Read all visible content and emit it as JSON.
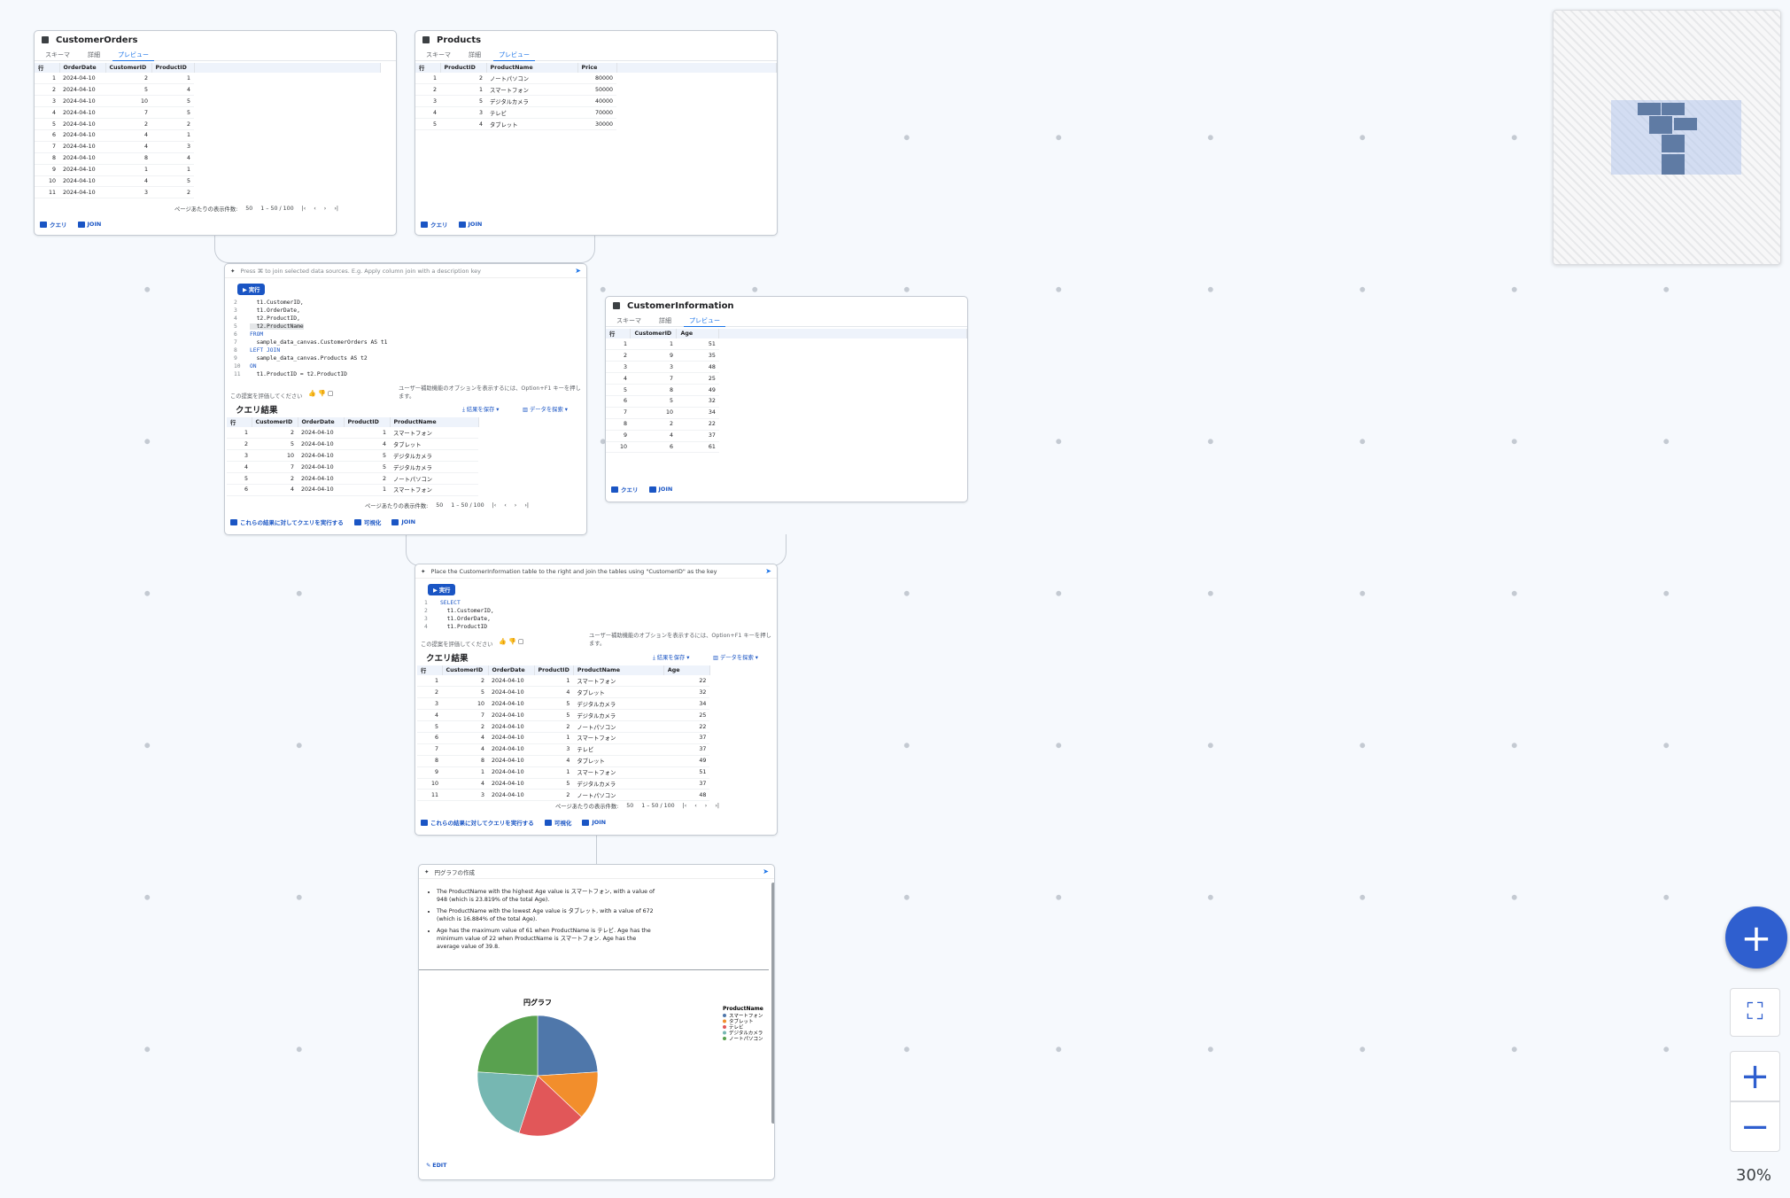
{
  "customer_orders": {
    "title": "CustomerOrders",
    "tabs": [
      "スキーマ",
      "詳細",
      "プレビュー"
    ],
    "columns": [
      "行",
      "OrderDate",
      "CustomerID",
      "ProductID"
    ],
    "rows": [
      [
        "1",
        "2024-04-10",
        "2",
        "1"
      ],
      [
        "2",
        "2024-04-10",
        "5",
        "4"
      ],
      [
        "3",
        "2024-04-10",
        "10",
        "5"
      ],
      [
        "4",
        "2024-04-10",
        "7",
        "5"
      ],
      [
        "5",
        "2024-04-10",
        "2",
        "2"
      ],
      [
        "6",
        "2024-04-10",
        "4",
        "1"
      ],
      [
        "7",
        "2024-04-10",
        "4",
        "3"
      ],
      [
        "8",
        "2024-04-10",
        "8",
        "4"
      ],
      [
        "9",
        "2024-04-10",
        "1",
        "1"
      ],
      [
        "10",
        "2024-04-10",
        "4",
        "5"
      ],
      [
        "11",
        "2024-04-10",
        "3",
        "2"
      ]
    ],
    "page_size_label": "ページあたりの表示件数:",
    "page_size": "50",
    "range": "1 – 50 / 100",
    "query_label": "クエリ",
    "join_label": "JOIN"
  },
  "products": {
    "title": "Products",
    "tabs": [
      "スキーマ",
      "詳細",
      "プレビュー"
    ],
    "columns": [
      "行",
      "ProductID",
      "ProductName",
      "Price"
    ],
    "rows": [
      [
        "1",
        "2",
        "ノートパソコン",
        "80000"
      ],
      [
        "2",
        "1",
        "スマートフォン",
        "50000"
      ],
      [
        "3",
        "5",
        "デジタルカメラ",
        "40000"
      ],
      [
        "4",
        "3",
        "テレビ",
        "70000"
      ],
      [
        "5",
        "4",
        "タブレット",
        "30000"
      ]
    ],
    "query_label": "クエリ",
    "join_label": "JOIN"
  },
  "customer_information": {
    "title": "CustomerInformation",
    "tabs": [
      "スキーマ",
      "詳細",
      "プレビュー"
    ],
    "columns": [
      "行",
      "CustomerID",
      "Age"
    ],
    "rows": [
      [
        "1",
        "1",
        "51"
      ],
      [
        "2",
        "9",
        "35"
      ],
      [
        "3",
        "3",
        "48"
      ],
      [
        "4",
        "7",
        "25"
      ],
      [
        "5",
        "8",
        "49"
      ],
      [
        "6",
        "5",
        "32"
      ],
      [
        "7",
        "10",
        "34"
      ],
      [
        "8",
        "2",
        "22"
      ],
      [
        "9",
        "4",
        "37"
      ],
      [
        "10",
        "6",
        "61"
      ]
    ],
    "query_label": "クエリ",
    "join_label": "JOIN"
  },
  "query1": {
    "prompt": "Press ⌘ to join selected data sources. E.g. Apply column join with a description key",
    "run_label": "実行",
    "code_lines": [
      {
        "n": "2",
        "t": "  t1.CustomerID,"
      },
      {
        "n": "3",
        "t": "  t1.OrderDate,"
      },
      {
        "n": "4",
        "t": "  t2.ProductID,"
      },
      {
        "n": "5",
        "t": "  t2.ProductName"
      },
      {
        "n": "6",
        "t": "FROM"
      },
      {
        "n": "7",
        "t": "  sample_data_canvas.CustomerOrders AS t1"
      },
      {
        "n": "8",
        "t": "LEFT JOIN"
      },
      {
        "n": "9",
        "t": "  sample_data_canvas.Products AS t2"
      },
      {
        "n": "10",
        "t": "ON"
      },
      {
        "n": "11",
        "t": "  t1.ProductID = t2.ProductID"
      }
    ],
    "hint": "ユーザー補助機能のオプションを表示するには、Option+F1 キーを押します。",
    "rate_label": "この提案を評価してください",
    "results_title": "クエリ結果",
    "save_label": "結果を保存",
    "explore_label": "データを探索",
    "columns": [
      "行",
      "CustomerID",
      "OrderDate",
      "ProductID",
      "ProductName"
    ],
    "rows": [
      [
        "1",
        "2",
        "2024-04-10",
        "1",
        "スマートフォン"
      ],
      [
        "2",
        "5",
        "2024-04-10",
        "4",
        "タブレット"
      ],
      [
        "3",
        "10",
        "2024-04-10",
        "5",
        "デジタルカメラ"
      ],
      [
        "4",
        "7",
        "2024-04-10",
        "5",
        "デジタルカメラ"
      ],
      [
        "5",
        "2",
        "2024-04-10",
        "2",
        "ノートパソコン"
      ],
      [
        "6",
        "4",
        "2024-04-10",
        "1",
        "スマートフォン"
      ]
    ],
    "page_size_label": "ページあたりの表示件数:",
    "page_size": "50",
    "range": "1 – 50 / 100",
    "run_on_results": "これらの結果に対してクエリを実行する",
    "visualize": "可視化",
    "join_label": "JOIN"
  },
  "query2": {
    "prompt": "Place the CustomerInformation table to the right and join the tables using \"CustomerID\" as the key",
    "run_label": "実行",
    "code_lines": [
      {
        "n": "1",
        "t": "SELECT"
      },
      {
        "n": "2",
        "t": "  t1.CustomerID,"
      },
      {
        "n": "3",
        "t": "  t1.OrderDate,"
      },
      {
        "n": "4",
        "t": "  t1.ProductID"
      }
    ],
    "hint": "ユーザー補助機能のオプションを表示するには、Option+F1 キーを押します。",
    "rate_label": "この提案を評価してください",
    "results_title": "クエリ結果",
    "save_label": "結果を保存",
    "explore_label": "データを探索",
    "columns": [
      "行",
      "CustomerID",
      "OrderDate",
      "ProductID",
      "ProductName",
      "Age"
    ],
    "rows": [
      [
        "1",
        "2",
        "2024-04-10",
        "1",
        "スマートフォン",
        "22"
      ],
      [
        "2",
        "5",
        "2024-04-10",
        "4",
        "タブレット",
        "32"
      ],
      [
        "3",
        "10",
        "2024-04-10",
        "5",
        "デジタルカメラ",
        "34"
      ],
      [
        "4",
        "7",
        "2024-04-10",
        "5",
        "デジタルカメラ",
        "25"
      ],
      [
        "5",
        "2",
        "2024-04-10",
        "2",
        "ノートパソコン",
        "22"
      ],
      [
        "6",
        "4",
        "2024-04-10",
        "1",
        "スマートフォン",
        "37"
      ],
      [
        "7",
        "4",
        "2024-04-10",
        "3",
        "テレビ",
        "37"
      ],
      [
        "8",
        "8",
        "2024-04-10",
        "4",
        "タブレット",
        "49"
      ],
      [
        "9",
        "1",
        "2024-04-10",
        "1",
        "スマートフォン",
        "51"
      ],
      [
        "10",
        "4",
        "2024-04-10",
        "5",
        "デジタルカメラ",
        "37"
      ],
      [
        "11",
        "3",
        "2024-04-10",
        "2",
        "ノートパソコン",
        "48"
      ]
    ],
    "page_size_label": "ページあたりの表示件数:",
    "page_size": "50",
    "range": "1 – 50 / 100",
    "run_on_results": "これらの結果に対してクエリを実行する",
    "visualize": "可視化",
    "join_label": "JOIN"
  },
  "visualization": {
    "prompt": "円グラフの作成",
    "bullets": [
      "The ProductName with the highest Age value is スマートフォン, with a value of 948 (which is 23.819% of the total Age).",
      "The ProductName with the lowest Age value is タブレット, with a value of 672 (which is 16.884% of the total Age).",
      "Age has the maximum value of 61 when ProductName is テレビ. Age has the minimum value of 22 when ProductName is スマートフォン. Age has the average value of 39.8."
    ],
    "edit_label": "EDIT"
  },
  "chart_data": {
    "type": "pie",
    "title": "円グラフ",
    "legend_title": "ProductName",
    "categories": [
      "スマートフォン",
      "タブレット",
      "テレビ",
      "デジタルカメラ",
      "ノートパソコン"
    ],
    "values": [
      24,
      13,
      18,
      21,
      24
    ],
    "colors": [
      "#4f77aa",
      "#f28e2c",
      "#e15759",
      "#76b7b2",
      "#59a14f"
    ],
    "legend_placement": "right"
  },
  "controls": {
    "add": "+",
    "zoom_in": "+",
    "zoom_out": "−",
    "zoom_level": "30%"
  },
  "colors": {
    "accent": "#2f5fcf",
    "canvas": "#f6f9fd"
  }
}
